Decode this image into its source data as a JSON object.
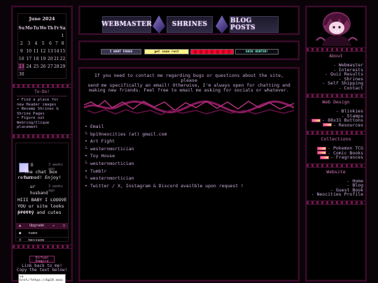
{
  "calendar": {
    "title": "June 2024",
    "weekdays": [
      "Su",
      "Mo",
      "Tu",
      "We",
      "Th",
      "Fr",
      "Sa"
    ],
    "weeks": [
      [
        "",
        "",
        "",
        "",
        "",
        "",
        "1"
      ],
      [
        "2",
        "3",
        "4",
        "5",
        "6",
        "7",
        "8"
      ],
      [
        "9",
        "10",
        "11",
        "12",
        "13",
        "14",
        "15"
      ],
      [
        "16",
        "17",
        "18",
        "19",
        "20",
        "21",
        "22"
      ],
      [
        "23",
        "24",
        "25",
        "26",
        "27",
        "28",
        "29"
      ],
      [
        "30",
        "",
        "",
        "",
        "",
        "",
        ""
      ]
    ],
    "today": "23"
  },
  "todo": {
    "title": "To-Do!",
    "items": [
      "• Find a place for",
      "new Header images",
      "• Revamp Shrines &",
      "Shrine Pages",
      "• Figure out",
      "Webring/Clique",
      "placement"
    ]
  },
  "guestbook": {
    "entries": [
      {
        "name": "D",
        "time": "3 weeks ago",
        "text_lines": [
          "The chat box has",
          "returned! Enjoy!"
        ]
      },
      {
        "name": "ur",
        "name2": "husband",
        "time": "3 weeks ago",
        "text_lines": [
          "HIII BABY I LOOOVE",
          "YOU ur site looks sooooo",
          "pretty and cutes"
        ]
      }
    ],
    "upgrade_label": "Upgrade",
    "name_placeholder": "name",
    "message_placeholder": "message",
    "name_counter": "",
    "message_counter": "",
    "logo_text": "Virtual Vampire"
  },
  "linkback": {
    "lines": [
      "Link back to me!",
      "Copy the text below!"
    ],
    "code_lines": [
      "<a",
      "href=\"https://bp19.neoc"
    ]
  },
  "nav": {
    "buttons": [
      "WEBMASTER",
      "SHRINES",
      "BLOG POSTS"
    ],
    "badges": [
      "I WANT FANGS",
      "get some rest",
      "",
      "SHIN HUNTER!"
    ]
  },
  "main": {
    "intro_lines": [
      "If you need to contact me regarding bugs or questions about the site, please",
      "send me specifically an email! Otherwise, I'm always open for chatting and",
      "making new friends. Feel free to email me asking for socials or whatever."
    ],
    "contacts": [
      "• Email",
      "└ bp19neocities (at) gmail.com",
      "• Art Fight",
      "└ westernmortician",
      "• Toy House",
      "└ westernmortician",
      "• Tumblr",
      "└ westernmortician",
      "• Twitter / X, Instagram & Discord availble upon request !"
    ]
  },
  "right": {
    "about": {
      "title": "About",
      "items": [
        "- Webmaster",
        "- Interests",
        "- Quiz Results",
        "- Shrines",
        "- Self Shipping",
        "- Contact"
      ]
    },
    "design": {
      "title": "Web Design",
      "items": [
        "- Blinkies",
        "- Stamps",
        "- 88x31 Buttons",
        "- Resources"
      ]
    },
    "collections": {
      "title": "Collections",
      "items": [
        "- Pokemon TCG",
        "- Comic Books",
        "- Fragrances"
      ]
    },
    "website": {
      "title": "Website",
      "items": [
        "- Home",
        "- Blog",
        "- Guest Book",
        "- Neocities Profile"
      ]
    }
  },
  "colors": {
    "accent": "#d97ab8",
    "border": "#3b0b2c",
    "text": "#c9a9d9"
  }
}
